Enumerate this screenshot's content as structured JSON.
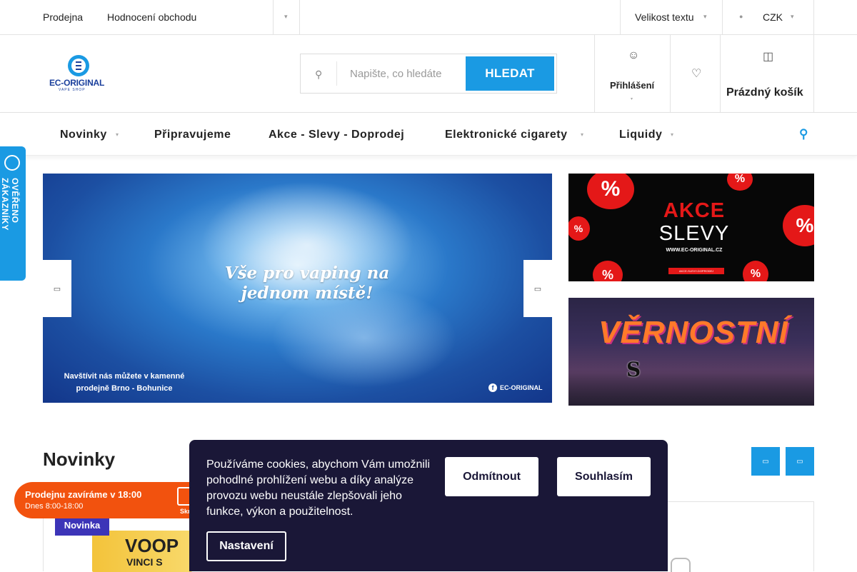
{
  "topbar": {
    "link1": "Prodejna",
    "link2": "Hodnocení obchodu",
    "more_icon": "chevron-down-icon",
    "text_size": "Velikost textu",
    "currency": "CZK"
  },
  "header": {
    "logo_text": "EC-ORIGINAL",
    "logo_sub": "VAPE SHOP",
    "search": {
      "placeholder": "Napište, co hledáte",
      "button": "HLEDAT"
    },
    "login_label": "Přihlášení",
    "cart_label": "Prázdný košík"
  },
  "nav": {
    "items": [
      "Novinky",
      "Připravujeme",
      "Akce - Slevy - Doprodej",
      "Elektronické cigarety",
      "Liquidy"
    ]
  },
  "badge": {
    "text": "OVĚŘENO ZÁKAZNÍKY"
  },
  "hero": {
    "headline": "Vše pro vaping na jednom místě!",
    "footer": "Navštívit nás můžete v kamenné prodejně Brno - Bohunice",
    "brand": "EC-ORIGINAL"
  },
  "banner_akce": {
    "line1": "AKCE",
    "line2": "SLEVY",
    "url": "WWW.EC-ORIGINAL.CZ",
    "tag": "AKCE-SLEVY-DOPRODEJ",
    "pct": "%"
  },
  "banner_vernost": {
    "title": "VĚRNOSTNÍ",
    "s": "S"
  },
  "section": {
    "title": "Novinky"
  },
  "product": {
    "tag": "Novinka",
    "brand": "VOOP",
    "model": "VINCI S"
  },
  "store": {
    "closing": "Prodejnu zavíráme v 18:00",
    "hours": "Dnes 8:00-18:00",
    "hide": "Skrýt"
  },
  "cookie": {
    "text": "Používáme cookies, abychom Vám umožnili pohodlné prohlížení webu a díky analýze provozu webu neustále zlepšovali jeho funkce, výkon a použitelnost.",
    "decline": "Odmítnout",
    "accept": "Souhlasím",
    "settings": "Nastavení"
  },
  "colors": {
    "accent": "#1a9ae3",
    "cookie_bg": "#1a1737",
    "store_orange": "#f2520e",
    "novinka_tag": "#3c34b8",
    "sale_red": "#e41818"
  }
}
